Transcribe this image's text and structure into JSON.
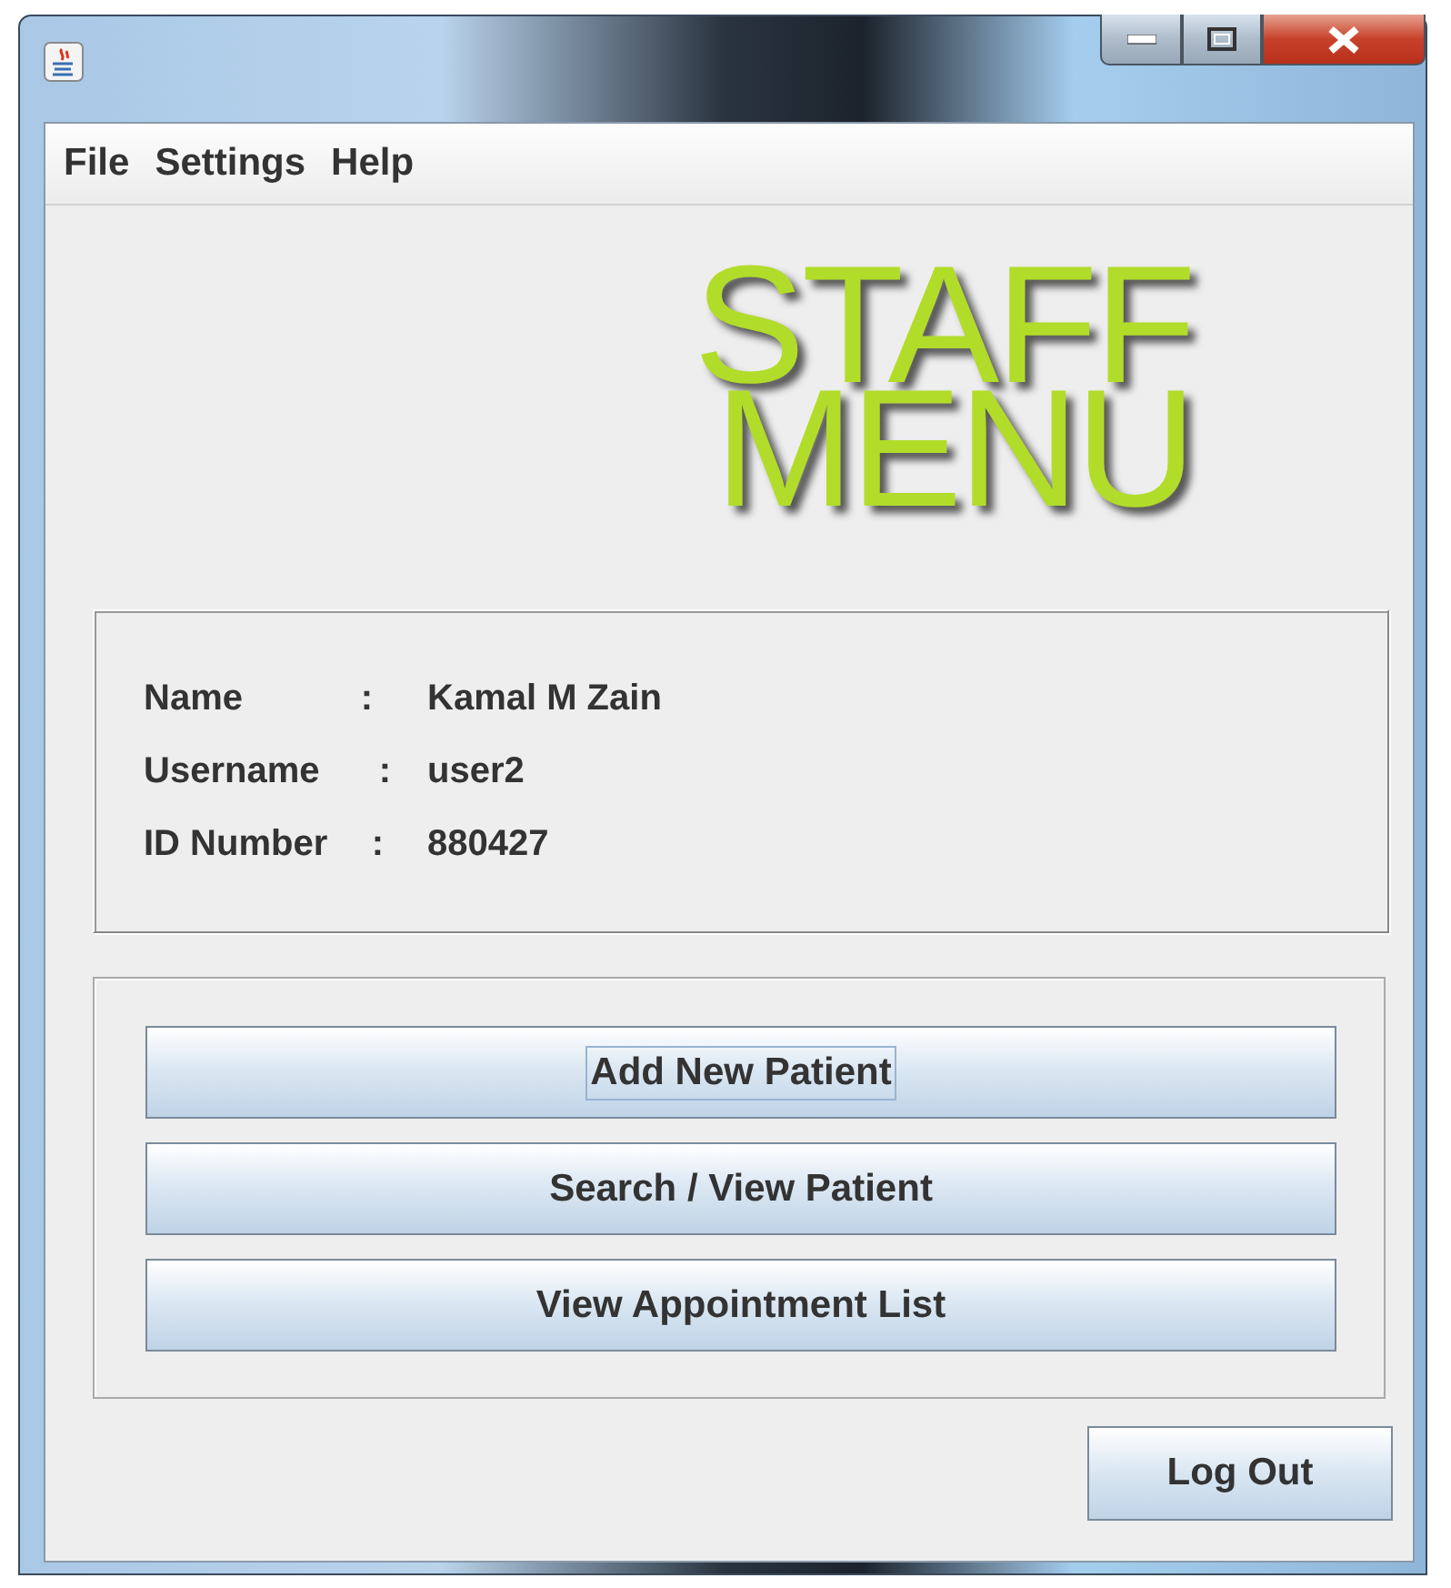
{
  "menu_bar": {
    "items": [
      {
        "label": "File"
      },
      {
        "label": "Settings"
      },
      {
        "label": "Help"
      }
    ]
  },
  "logo": {
    "lines": [
      "STAFF",
      "MENU"
    ]
  },
  "profile": {
    "fields": [
      {
        "label": "Name",
        "separator": ":",
        "value": "Kamal M Zain"
      },
      {
        "label": "Username",
        "separator": ":",
        "value": "user2"
      },
      {
        "label": "ID Number",
        "separator": ":",
        "value": "880427"
      }
    ]
  },
  "actions": [
    {
      "label": "Add New Patient",
      "focused": true
    },
    {
      "label": "Search / View Patient",
      "focused": false
    },
    {
      "label": "View Appointment List",
      "focused": false
    }
  ],
  "logout": {
    "label": "Log Out"
  }
}
